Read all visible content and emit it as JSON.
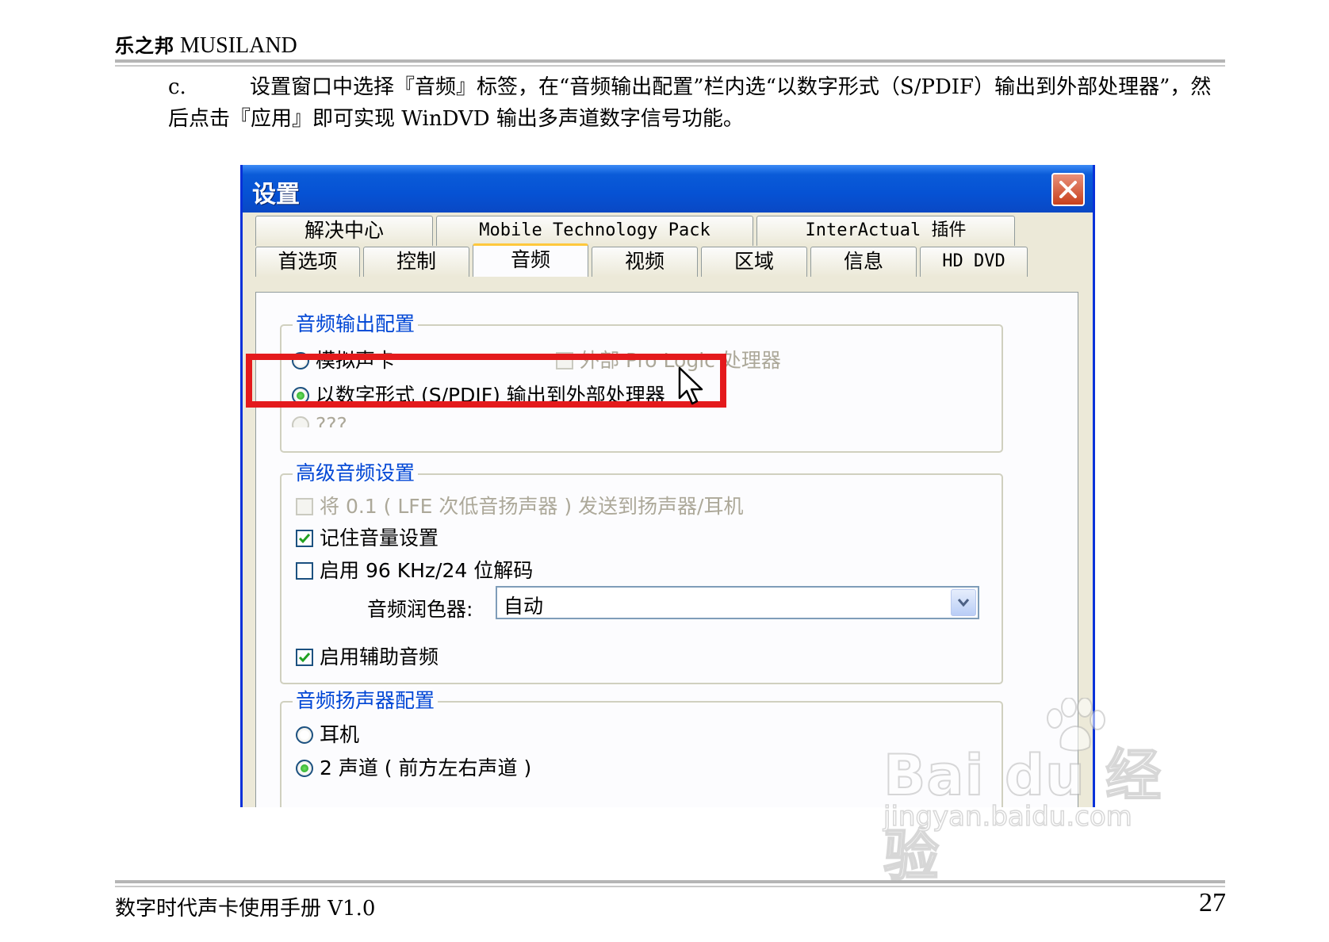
{
  "document": {
    "header_brand_cn": "乐之邦",
    "header_brand_en": "MUSILAND",
    "instruction_step": "c.",
    "instruction_text": "设置窗口中选择『音频』标签，在“音频输出配置”栏内选“以数字形式（S/PDIF）输出到外部处理器”，然后点击『应用』即可实现 WinDVD 输出多声道数字信号功能。",
    "footer_title": "数字时代声卡使用手册 V1.0",
    "page_number": "27"
  },
  "dialog": {
    "title": "设置",
    "tabs_row1": [
      "解决中心",
      "Mobile Technology Pack",
      "InterActual 插件"
    ],
    "tabs_row2": [
      "首选项",
      "控制",
      "音频",
      "视频",
      "区域",
      "信息",
      "HD DVD"
    ],
    "active_tab": "音频",
    "audio_output": {
      "title": "音频输出配置",
      "analog": "模拟声卡",
      "pro_logic": "外部 Pro Logic 处理器",
      "digital": "以数字形式 (S/PDIF) 输出到外部处理器",
      "third_option_partial": "???"
    },
    "advanced": {
      "title": "高级音频设置",
      "lfe": "将 0.1 ( LFE 次低音扬声器 ) 发送到扬声器/耳机",
      "remember_volume": "记住音量设置",
      "enable_96k": "启用 96 KHz/24 位解码",
      "enhancer_label": "音频润色器:",
      "enhancer_value": "自动",
      "aux_audio": "启用辅助音频"
    },
    "speaker": {
      "title": "音频扬声器配置",
      "headphones": "耳机",
      "two_channel": "2 声道 ( 前方左右声道 )"
    }
  },
  "watermark": {
    "brand": "Bai du 经验",
    "url": "jingyan.baidu.com"
  },
  "colors": {
    "highlight": "#e41a1c",
    "title_bar": "#0652d4",
    "group_title": "#0046d5"
  }
}
